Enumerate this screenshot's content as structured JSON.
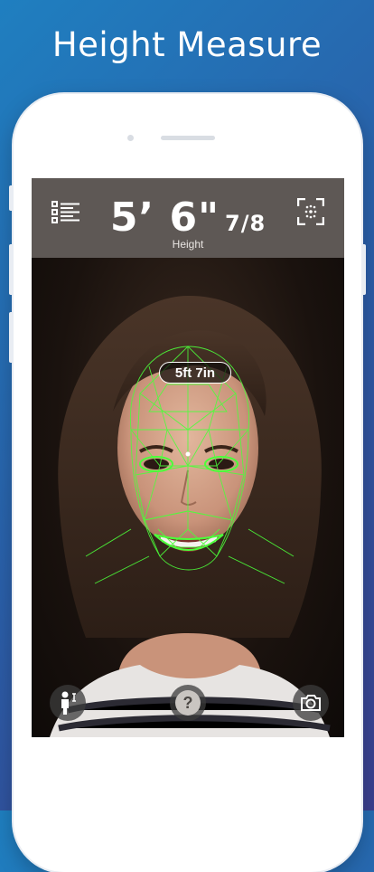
{
  "promo": {
    "title": "Height Measure"
  },
  "app": {
    "height_main": "5’ 6\"",
    "height_fraction": "7/8",
    "height_label": "Height",
    "badge": "5ft 7in"
  },
  "icons": {
    "menu": "list-icon",
    "scan": "face-scan-icon",
    "person": "person-height-icon",
    "help": "help-icon",
    "camera": "camera-icon"
  },
  "colors": {
    "background_gradient_start": "#1f7fc0",
    "background_gradient_end": "#3a3f8e",
    "topbar": "#5e5855",
    "mesh": "#4cff3a"
  }
}
